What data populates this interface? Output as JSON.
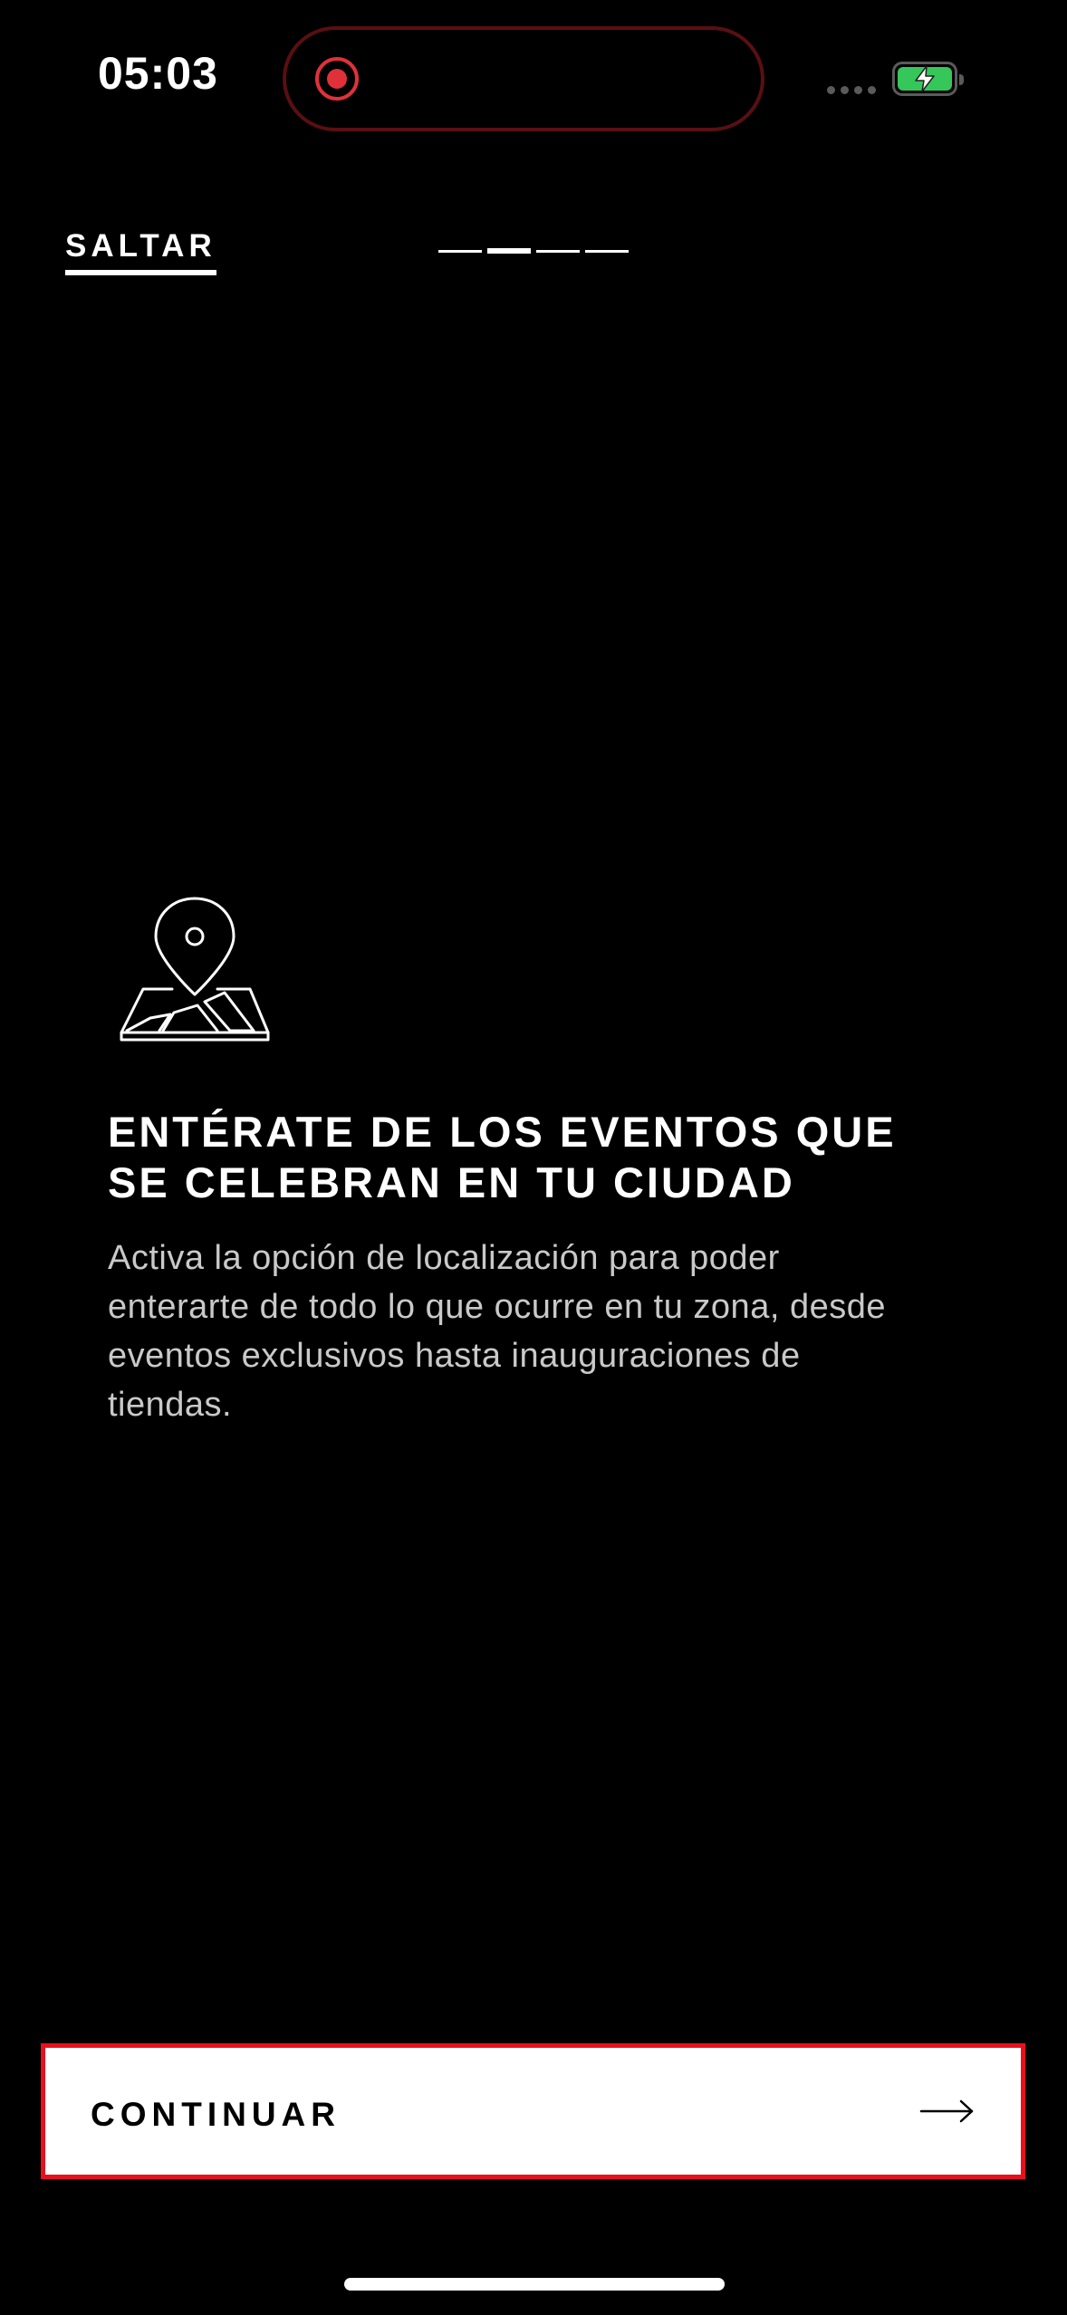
{
  "status_bar": {
    "time": "05:03",
    "battery_color": "#35c759",
    "recording_color": "#e0313a",
    "icons": [
      "screen-recording-icon",
      "cellular-signal-icon",
      "battery-charging-icon"
    ]
  },
  "nav": {
    "skip_label": "SALTAR",
    "pager": {
      "total": 4,
      "active_index": 1
    }
  },
  "content": {
    "icon": "map-pin-icon",
    "headline_lines": [
      "ENTÉRATE DE LOS EVENTOS QUE",
      "SE CELEBRAN EN TU CIUDAD"
    ],
    "body_lines": [
      "Activa la opción de localización para poder",
      "enterarte de todo lo que ocurre en tu zona, desde",
      "eventos exclusivos hasta inauguraciones de",
      "tiendas."
    ]
  },
  "footer": {
    "continue_label": "CONTINUAR",
    "continue_icon": "arrow-right-icon",
    "accent_border_color": "#e8101c"
  }
}
